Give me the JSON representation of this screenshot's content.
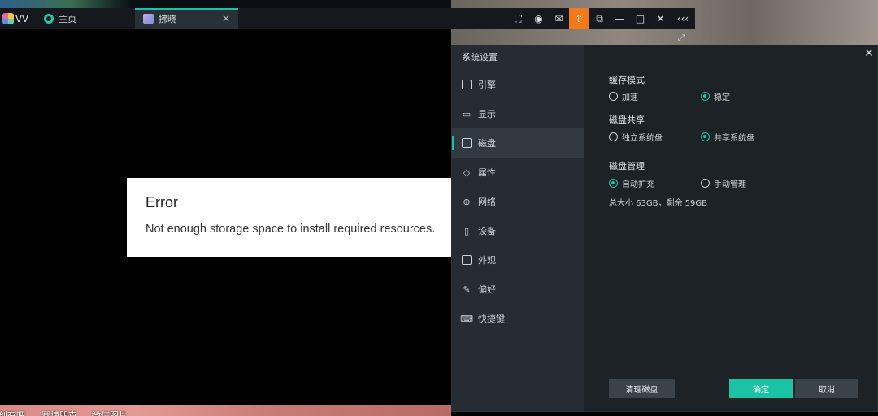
{
  "desktop": {
    "icon_labels": [
      "创有吧",
      "赛博朋克",
      "微信图片"
    ]
  },
  "titlebar": {
    "app_name": "VV",
    "tabs": [
      {
        "label": "主页"
      },
      {
        "label": "拂晓"
      }
    ],
    "tab_close": "✕",
    "controls": {
      "screenshot": "⛶",
      "account": "◉",
      "mail": "✉",
      "upload": "⇧",
      "window": "⧉",
      "minimize": "—",
      "maximize": "□",
      "close": "✕",
      "collapse": "‹‹‹"
    },
    "upload_color": "#f27a1a",
    "accent": "#19c3a4"
  },
  "error_dialog": {
    "title": "Error",
    "message": "Not enough storage space to install required resources."
  },
  "settings": {
    "title": "系统设置",
    "close": "✕",
    "nav": [
      {
        "label": "引擎",
        "icon": "chip-icon"
      },
      {
        "label": "显示",
        "icon": "monitor-icon"
      },
      {
        "label": "磁盘",
        "icon": "disk-icon",
        "active": true
      },
      {
        "label": "属性",
        "icon": "tag-icon"
      },
      {
        "label": "网络",
        "icon": "globe-icon"
      },
      {
        "label": "设备",
        "icon": "phone-icon"
      },
      {
        "label": "外观",
        "icon": "window-icon"
      },
      {
        "label": "偏好",
        "icon": "wrench-icon"
      },
      {
        "label": "快捷键",
        "icon": "keyboard-icon"
      }
    ],
    "cache_mode": {
      "title": "缓存模式",
      "options": [
        {
          "label": "加速",
          "selected": false
        },
        {
          "label": "稳定",
          "selected": true
        }
      ]
    },
    "disk_share": {
      "title": "磁盘共享",
      "options": [
        {
          "label": "独立系统盘",
          "selected": false
        },
        {
          "label": "共享系统盘",
          "selected": true
        }
      ]
    },
    "disk_manage": {
      "title": "磁盘管理",
      "options": [
        {
          "label": "自动扩充",
          "selected": true
        },
        {
          "label": "手动管理",
          "selected": false
        }
      ],
      "info": "总大小 63GB，剩余 59GB"
    },
    "buttons": {
      "clean": "清理磁盘",
      "ok": "确定",
      "cancel": "取消"
    }
  }
}
